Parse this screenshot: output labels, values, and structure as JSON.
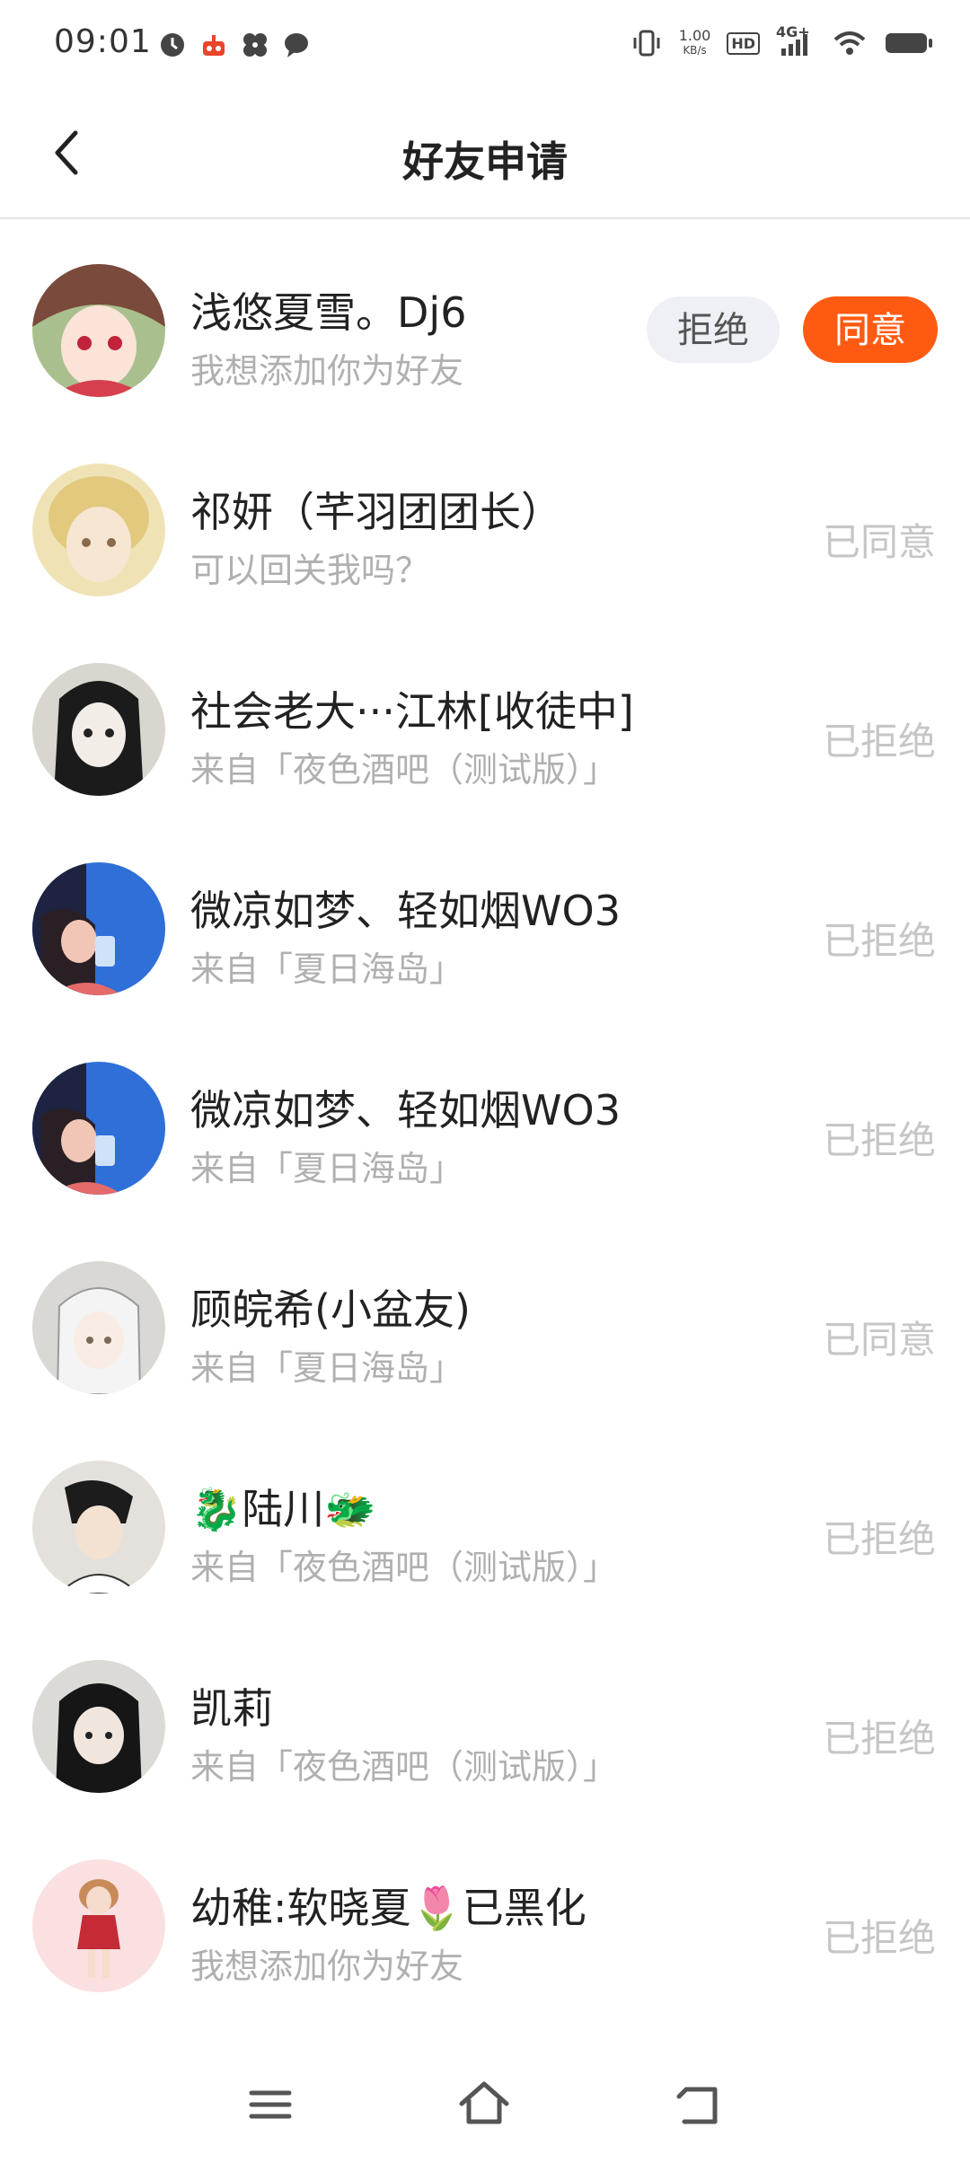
{
  "status_bar": {
    "time": "09:01",
    "net_speed_value": "1.00",
    "net_speed_unit": "KB/s",
    "hd_label": "HD",
    "network_label": "4G+",
    "icons": [
      "clock-icon",
      "robot-icon",
      "pinwheel-icon",
      "chat-bubble-icon",
      "vibrate-icon",
      "signal-icon",
      "wifi-icon",
      "battery-icon"
    ]
  },
  "header": {
    "title": "好友申请",
    "back_icon": "back-arrow-icon"
  },
  "buttons": {
    "reject_label": "拒绝",
    "accept_label": "同意"
  },
  "requests": [
    {
      "name": "浅悠夏雪。Dj6",
      "message": "我想添加你为好友",
      "status": ""
    },
    {
      "name": "祁妍（芊羽团团长）",
      "message": "可以回关我吗？",
      "status": "已同意"
    },
    {
      "name": "社会老大···江林[收徒中]",
      "message": "来自「夜色酒吧（测试版）」",
      "status": "已拒绝"
    },
    {
      "name": "微凉如梦、轻如烟WO3",
      "message": "来自「夏日海岛」",
      "status": "已拒绝"
    },
    {
      "name": "微凉如梦、轻如烟WO3",
      "message": "来自「夏日海岛」",
      "status": "已拒绝"
    },
    {
      "name": "顾皖希(小盆友)",
      "message": "来自「夏日海岛」",
      "status": "已同意"
    },
    {
      "name": "🐉陆川🐲",
      "message": "来自「夜色酒吧（测试版）」",
      "status": "已拒绝"
    },
    {
      "name": "凯莉",
      "message": "来自「夜色酒吧（测试版）」",
      "status": "已拒绝"
    },
    {
      "name": "幼稚:软晓夏🌷已黑化",
      "message": "我想添加你为好友",
      "status": "已拒绝"
    }
  ],
  "nav_bar": {
    "icons": [
      "menu-icon",
      "home-icon",
      "back-icon"
    ]
  },
  "colors": {
    "accent": "#ff5a12",
    "reject_bg": "#eef0f5",
    "status_text": "#c6c6c6",
    "secondary_text": "#b0b0b0"
  }
}
